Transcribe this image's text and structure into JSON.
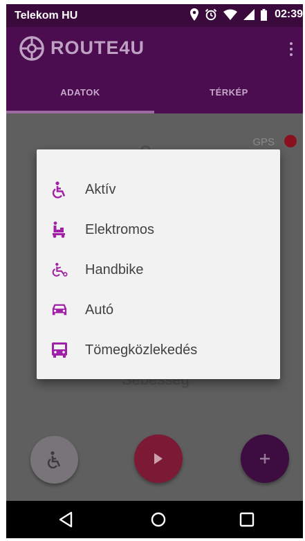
{
  "status_bar": {
    "carrier": "Telekom HU",
    "time": "02:39"
  },
  "app_bar": {
    "title": "ROUTE4U"
  },
  "tabs": [
    {
      "label": "ADATOK",
      "selected": true
    },
    {
      "label": "TÉRKÉP",
      "selected": false
    }
  ],
  "content": {
    "gps_label": "GPS",
    "gps_status_color": "#8a1020",
    "background_value": "0",
    "background_label": "Sebesség"
  },
  "dialog": {
    "options": [
      {
        "label": "Aktív",
        "icon": "wheelchair-active-icon"
      },
      {
        "label": "Elektromos",
        "icon": "electric-wheelchair-icon"
      },
      {
        "label": "Handbike",
        "icon": "handbike-icon"
      },
      {
        "label": "Autó",
        "icon": "car-icon"
      },
      {
        "label": "Tömegközlekedés",
        "icon": "bus-icon"
      }
    ]
  },
  "fabs": [
    {
      "icon": "wheelchair-icon"
    },
    {
      "icon": "play-icon"
    },
    {
      "icon": "plus-icon"
    }
  ],
  "colors": {
    "primary": "#4b0d4f",
    "accent": "#a020a8",
    "dialog_bg": "#f2f2f2"
  }
}
